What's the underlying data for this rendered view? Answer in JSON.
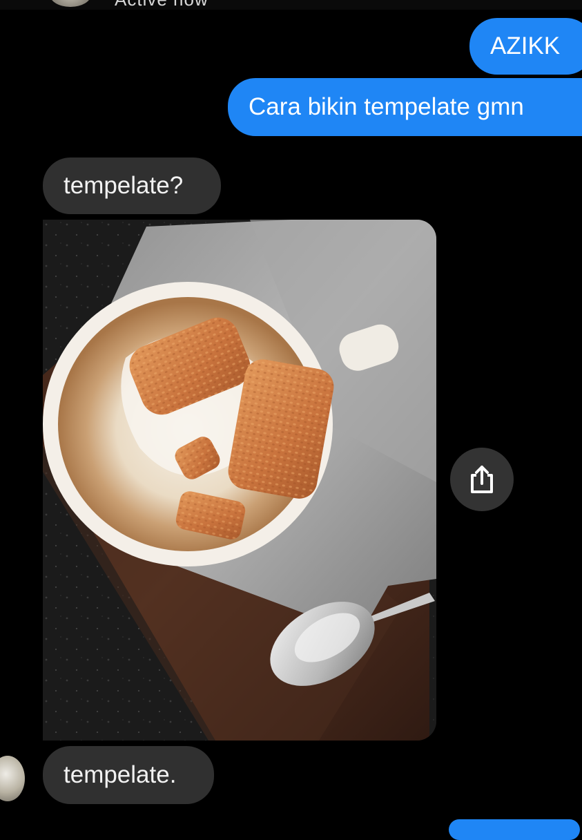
{
  "header": {
    "status_text": "Active now"
  },
  "messages": [
    {
      "direction": "outgoing",
      "text": "AZIKK"
    },
    {
      "direction": "outgoing",
      "text": "Cara bikin tempelate gmn"
    },
    {
      "direction": "incoming",
      "text": "tempelate?"
    },
    {
      "direction": "incoming",
      "type": "image"
    },
    {
      "direction": "incoming",
      "text": "tempelate."
    }
  ],
  "icons": {
    "share": "share-icon",
    "avatar": "avatar"
  },
  "colors": {
    "background": "#000000",
    "outgoing_bubble": "#1f86f5",
    "incoming_bubble": "#303030",
    "share_button": "#333333"
  }
}
